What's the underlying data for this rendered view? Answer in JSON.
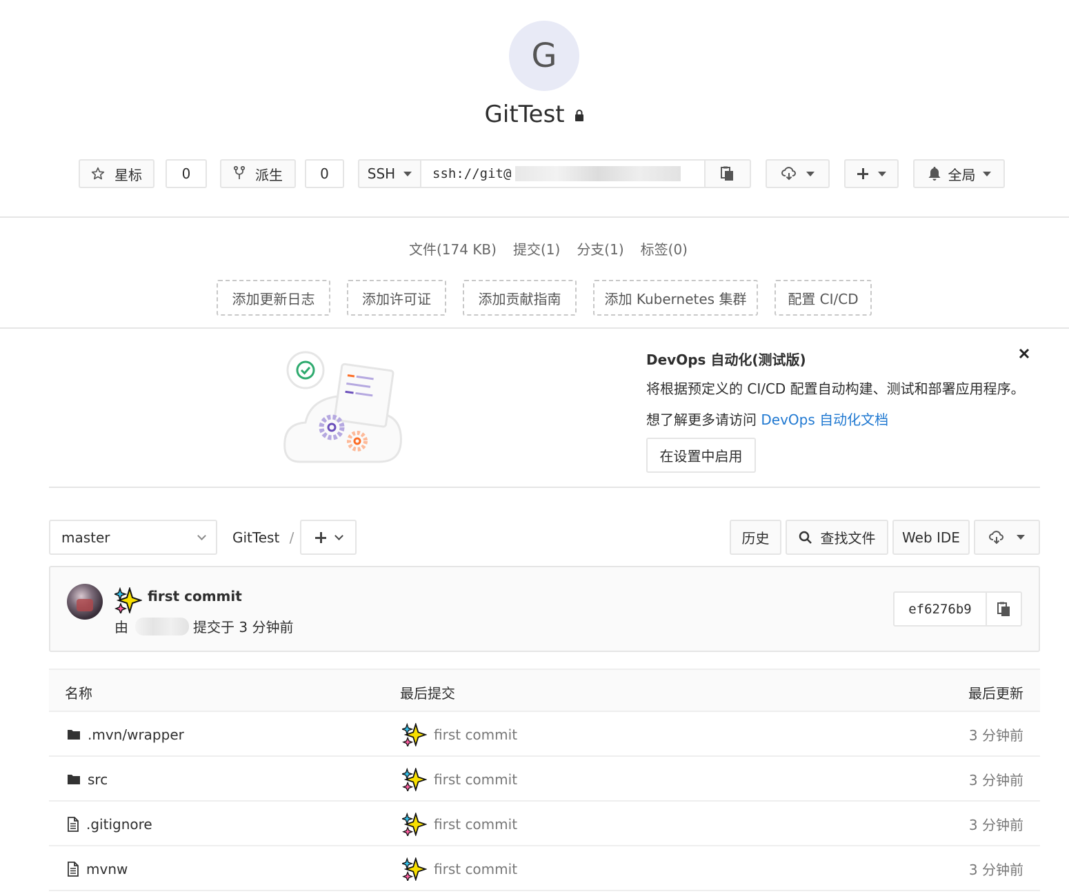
{
  "project": {
    "avatar_letter": "G",
    "name": "GitTest",
    "visibility_icon": "lock-icon"
  },
  "actions": {
    "star_label": "星标",
    "star_count": "0",
    "fork_label": "派生",
    "fork_count": "0",
    "clone_protocol": "SSH",
    "clone_url": "ssh://git@",
    "notification_label": "全局"
  },
  "stats": {
    "files": "文件(174 KB)",
    "commits": "提交(1)",
    "branches": "分支(1)",
    "tags": "标签(0)"
  },
  "quick_links": [
    "添加更新日志",
    "添加许可证",
    "添加贡献指南",
    "添加 Kubernetes 集群",
    "配置 CI/CD"
  ],
  "devops_banner": {
    "title": "DevOps 自动化(测试版)",
    "description": "将根据预定义的 CI/CD 配置自动构建、测试和部署应用程序。",
    "more_prefix": "想了解更多请访问",
    "more_link": "DevOps 自动化文档",
    "enable_button": "在设置中启用",
    "close_icon": "close-icon"
  },
  "toolbar": {
    "branch": "master",
    "breadcrumb_project": "GitTest",
    "breadcrumb_sep": "/",
    "history": "历史",
    "find_file": "查找文件",
    "web_ide": "Web IDE"
  },
  "last_commit": {
    "message": "first commit",
    "author_prefix": "由",
    "committed_text": "提交于 3 分钟前",
    "sha": "ef6276b9"
  },
  "file_table": {
    "headers": [
      "名称",
      "最后提交",
      "最后更新"
    ],
    "rows": [
      {
        "type": "folder",
        "name": ".mvn/wrapper",
        "commit": "first commit",
        "updated": "3 分钟前"
      },
      {
        "type": "folder",
        "name": "src",
        "commit": "first commit",
        "updated": "3 分钟前"
      },
      {
        "type": "file",
        "name": ".gitignore",
        "commit": "first commit",
        "updated": "3 分钟前"
      },
      {
        "type": "file",
        "name": "mvnw",
        "commit": "first commit",
        "updated": "3 分钟前"
      }
    ]
  },
  "colors": {
    "link": "#1f78d1",
    "avatar_bg": "#e8eaf6",
    "border": "#e5e5e5",
    "sparkle_yellow": "#f9e000",
    "check_green": "#2eaa6e"
  }
}
